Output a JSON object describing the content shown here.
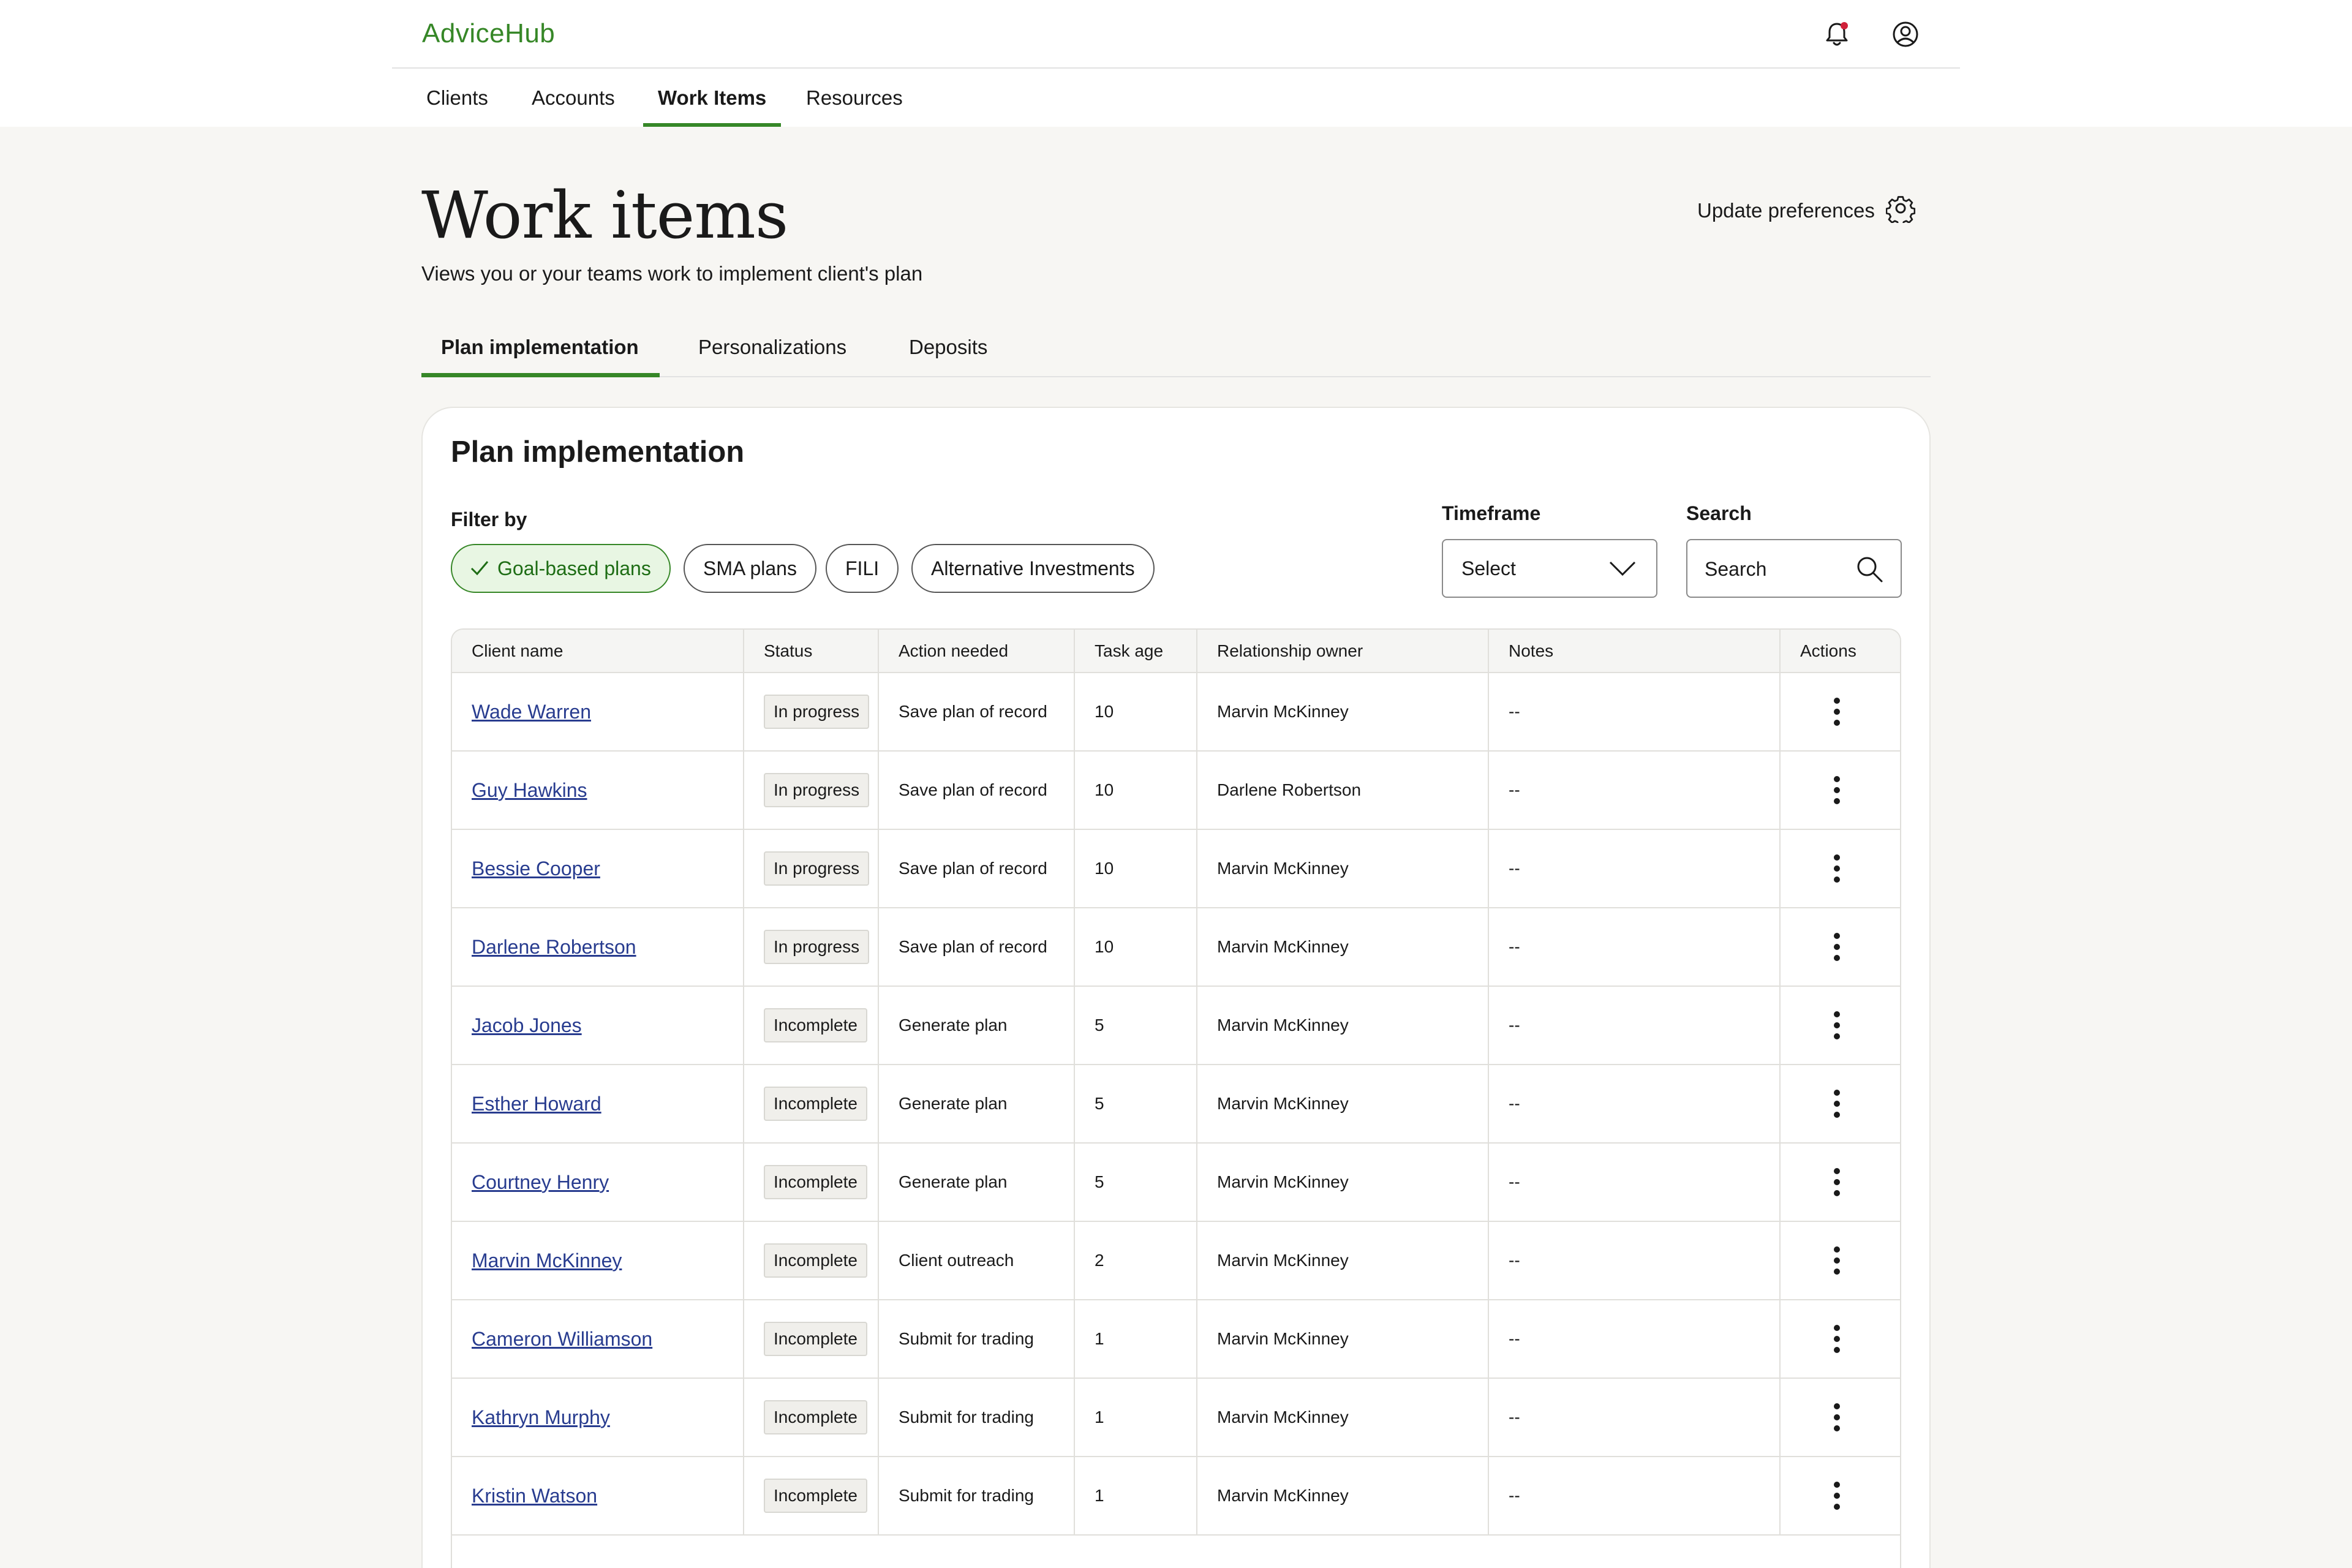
{
  "brand": {
    "name": "AdviceHub",
    "color": "#368727"
  },
  "header_icons": {
    "notifications": "bell-icon",
    "account": "user-circle-icon"
  },
  "nav": [
    {
      "label": "Clients"
    },
    {
      "label": "Accounts"
    },
    {
      "label": "Work Items",
      "active": true
    },
    {
      "label": "Resources"
    }
  ],
  "page": {
    "title": "Work items",
    "subtitle": "Views you or your teams work to implement client's plan",
    "preferences_label": "Update preferences"
  },
  "subtabs": [
    {
      "label": "Plan implementation",
      "active": true
    },
    {
      "label": "Personalizations"
    },
    {
      "label": "Deposits"
    }
  ],
  "card": {
    "title": "Plan implementation",
    "filter_label": "Filter by",
    "chips": [
      {
        "label": "Goal-based plans",
        "selected": true
      },
      {
        "label": "SMA plans"
      },
      {
        "label": "FILI"
      },
      {
        "label": "Alternative Investments"
      }
    ],
    "timeframe": {
      "label": "Timeframe",
      "value": "Select"
    },
    "search": {
      "label": "Search",
      "placeholder": "Search"
    }
  },
  "table": {
    "columns": [
      "Client name",
      "Status",
      "Action needed",
      "Task age",
      "Relationship owner",
      "Notes",
      "Actions"
    ],
    "rows": [
      {
        "client": "Wade Warren",
        "status": "In progress",
        "action": "Save plan of record",
        "age": "10",
        "owner": "Marvin McKinney",
        "notes": "--"
      },
      {
        "client": "Guy Hawkins",
        "status": "In progress",
        "action": "Save plan of record",
        "age": "10",
        "owner": "Darlene Robertson",
        "notes": "--"
      },
      {
        "client": "Bessie Cooper",
        "status": "In progress",
        "action": "Save plan of record",
        "age": "10",
        "owner": "Marvin McKinney",
        "notes": "--"
      },
      {
        "client": "Darlene Robertson",
        "status": "In progress",
        "action": "Save plan of record",
        "age": "10",
        "owner": "Marvin McKinney",
        "notes": "--"
      },
      {
        "client": "Jacob Jones",
        "status": "Incomplete",
        "action": "Generate plan",
        "age": "5",
        "owner": "Marvin McKinney",
        "notes": "--"
      },
      {
        "client": "Esther Howard",
        "status": "Incomplete",
        "action": "Generate plan",
        "age": "5",
        "owner": "Marvin McKinney",
        "notes": "--"
      },
      {
        "client": "Courtney Henry",
        "status": "Incomplete",
        "action": "Generate plan",
        "age": "5",
        "owner": "Marvin McKinney",
        "notes": "--"
      },
      {
        "client": "Marvin McKinney",
        "status": "Incomplete",
        "action": "Client outreach",
        "age": "2",
        "owner": "Marvin McKinney",
        "notes": "--"
      },
      {
        "client": "Cameron Williamson",
        "status": "Incomplete",
        "action": "Submit for trading",
        "age": "1",
        "owner": "Marvin McKinney",
        "notes": "--"
      },
      {
        "client": "Kathryn Murphy",
        "status": "Incomplete",
        "action": "Submit for trading",
        "age": "1",
        "owner": "Marvin McKinney",
        "notes": "--"
      },
      {
        "client": "Kristin Watson",
        "status": "Incomplete",
        "action": "Submit for trading",
        "age": "1",
        "owner": "Marvin McKinney",
        "notes": "--"
      }
    ]
  }
}
